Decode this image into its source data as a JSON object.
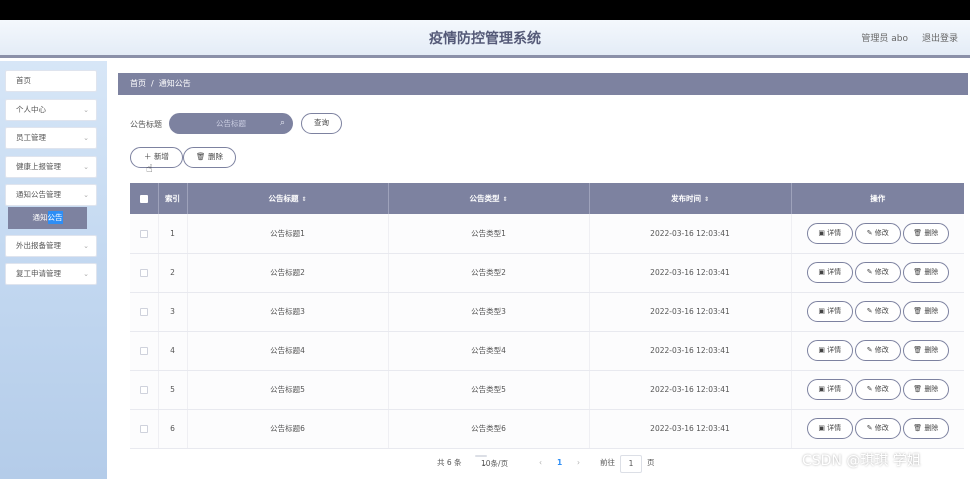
{
  "header": {
    "title": "疫情防控管理系统",
    "user_label": "管理员 abo",
    "logout_label": "退出登录"
  },
  "sidebar": {
    "items": [
      {
        "label": "首页",
        "has_arrow": false
      },
      {
        "label": "个人中心",
        "has_arrow": true
      },
      {
        "label": "员工管理",
        "has_arrow": true
      },
      {
        "label": "健康上报管理",
        "has_arrow": true
      },
      {
        "label": "通知公告管理",
        "has_arrow": true
      },
      {
        "label": "外出报备管理",
        "has_arrow": true
      },
      {
        "label": "复工申请管理",
        "has_arrow": true
      }
    ],
    "submenu_pre": "通知",
    "submenu_hl": "公告"
  },
  "breadcrumb": {
    "home": "首页",
    "separator": "/",
    "current": "通知公告"
  },
  "search": {
    "label": "公告标题",
    "placeholder": "公告标题",
    "button_label": "查询"
  },
  "toolbar": {
    "add_label": "新增",
    "delete_label": "删除"
  },
  "table": {
    "headers": [
      "索引",
      "公告标题",
      "公告类型",
      "发布时间",
      "操作"
    ],
    "rows": [
      {
        "index": "1",
        "title": "公告标题1",
        "type": "公告类型1",
        "time": "2022-03-16 12:03:41"
      },
      {
        "index": "2",
        "title": "公告标题2",
        "type": "公告类型2",
        "time": "2022-03-16 12:03:41"
      },
      {
        "index": "3",
        "title": "公告标题3",
        "type": "公告类型3",
        "time": "2022-03-16 12:03:41"
      },
      {
        "index": "4",
        "title": "公告标题4",
        "type": "公告类型4",
        "time": "2022-03-16 12:03:41"
      },
      {
        "index": "5",
        "title": "公告标题5",
        "type": "公告类型5",
        "time": "2022-03-16 12:03:41"
      },
      {
        "index": "6",
        "title": "公告标题6",
        "type": "公告类型6",
        "time": "2022-03-16 12:03:41"
      }
    ],
    "actions": {
      "detail": "详情",
      "edit": "修改",
      "delete": "删除"
    }
  },
  "pagination": {
    "total_text": "共 6 条",
    "page_size": "10条/页",
    "current_page": "1",
    "goto_label": "前往",
    "goto_value": "1",
    "page_suffix": "页"
  },
  "watermark": "CSDN @琪琪 学姐",
  "colors": {
    "accent": "#7d82a0",
    "highlight": "#2e8ef5"
  }
}
